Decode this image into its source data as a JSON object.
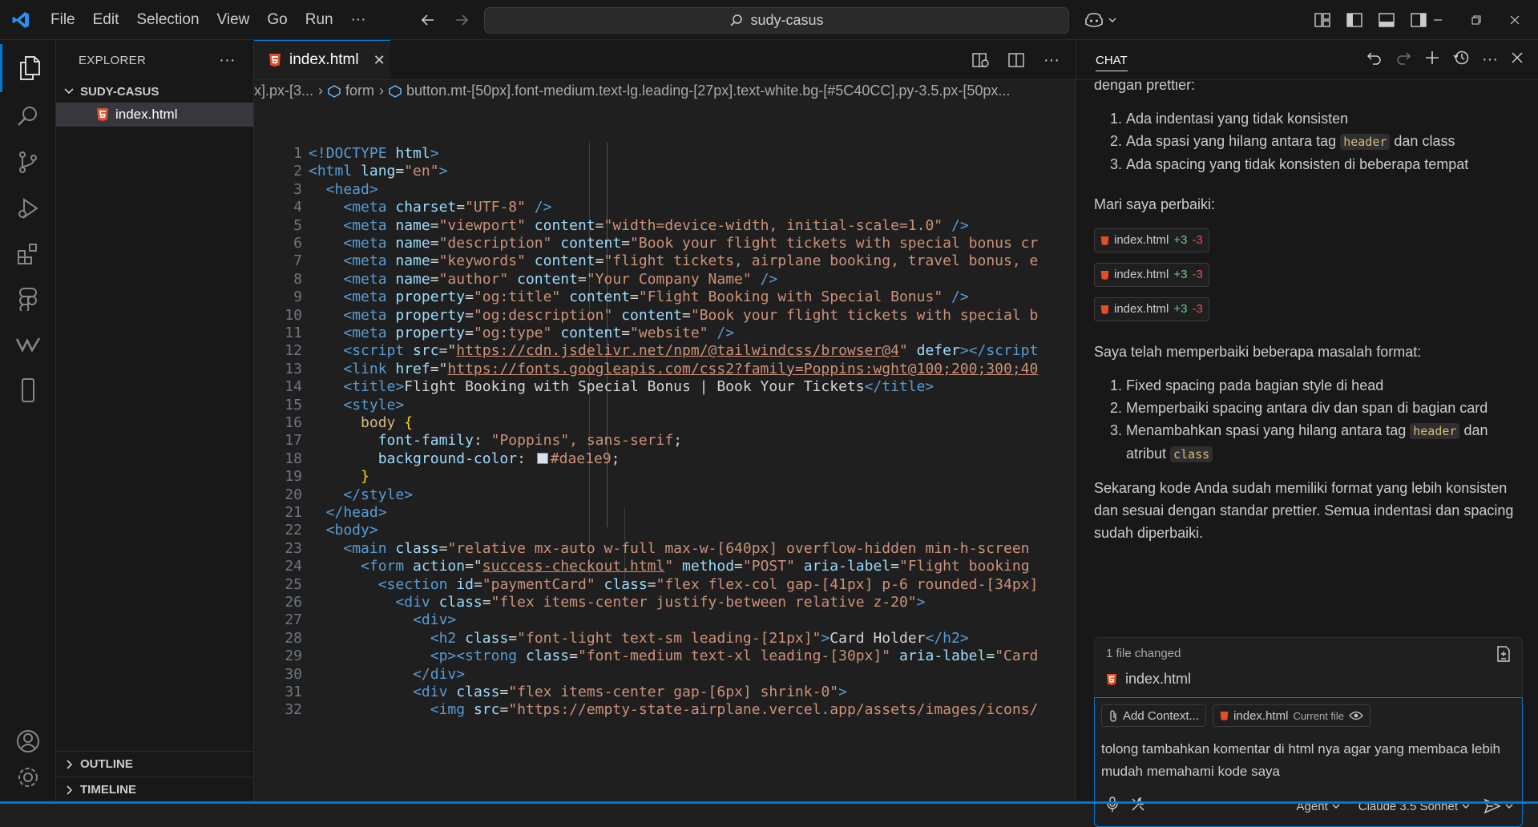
{
  "menu": [
    "File",
    "Edit",
    "Selection",
    "View",
    "Go",
    "Run",
    "···"
  ],
  "search": {
    "text": "sudy-casus"
  },
  "sidebar": {
    "title": "EXPLORER",
    "folder": "SUDY-CASUS",
    "files": [
      "index.html"
    ],
    "outline": "OUTLINE",
    "timeline": "TIMELINE"
  },
  "editor": {
    "tab": "index.html",
    "breadcrumb": {
      "part1": "x].px-[3...",
      "part2": "form",
      "part3": "button.mt-[50px].font-medium.text-lg.leading-[27px].text-white.bg-[#5C40CC].py-3.5.px-[50px..."
    },
    "swatch_color": "#dae1e9",
    "lines": [
      "1",
      "2",
      "3",
      "4",
      "5",
      "6",
      "7",
      "8",
      "9",
      "10",
      "11",
      "12",
      "13",
      "14",
      "15",
      "16",
      "17",
      "18",
      "19",
      "20",
      "21",
      "22",
      "23",
      "24",
      "25",
      "26",
      "27",
      "28",
      "29",
      "30",
      "31",
      "32"
    ],
    "code": {
      "l1": [
        "<!DOCTYPE",
        " html",
        ">"
      ],
      "l2": [
        "<html",
        " lang",
        "=",
        "\"en\"",
        ">"
      ],
      "l3": [
        "<head>"
      ],
      "l4": [
        "<meta",
        " charset",
        "=",
        "\"UTF-8\"",
        " />"
      ],
      "l5": [
        "<meta",
        " name",
        "=",
        "\"viewport\"",
        " content",
        "=",
        "\"width=device-width, initial-scale=1.0\"",
        " />"
      ],
      "l6": [
        "<meta",
        " name",
        "=",
        "\"description\"",
        " content",
        "=",
        "\"Book your flight tickets with special bonus cr"
      ],
      "l7": [
        "<meta",
        " name",
        "=",
        "\"keywords\"",
        " content",
        "=",
        "\"flight tickets, airplane booking, travel bonus, e"
      ],
      "l8": [
        "<meta",
        " name",
        "=",
        "\"author\"",
        " content",
        "=",
        "\"Your Company Name\"",
        " />"
      ],
      "l9": [
        "<meta",
        " property",
        "=",
        "\"og:title\"",
        " content",
        "=",
        "\"Flight Booking with Special Bonus\"",
        " />"
      ],
      "l10": [
        "<meta",
        " property",
        "=",
        "\"og:description\"",
        " content",
        "=",
        "\"Book your flight tickets with special b"
      ],
      "l11": [
        "<meta",
        " property",
        "=",
        "\"og:type\"",
        " content",
        "=",
        "\"website\"",
        " />"
      ],
      "l12": [
        "<script",
        " src",
        "=\"",
        "https://cdn.jsdelivr.net/npm/@tailwindcss/browser@4",
        "\"",
        " defer",
        "></script"
      ],
      "l13": [
        "<link",
        " href",
        "=\"",
        "https://fonts.googleapis.com/css2?family=Poppins:wght@100;200;300;40"
      ],
      "l14": [
        "<title>",
        "Flight Booking with Special Bonus | Book Your Tickets",
        "</title>"
      ],
      "l15": [
        "<style>"
      ],
      "l16": [
        "body",
        " {"
      ],
      "l17": [
        "font-family",
        ": ",
        "\"Poppins\", sans-serif",
        ";"
      ],
      "l18": [
        "background-color",
        ": ",
        "#dae1e9",
        ";"
      ],
      "l19": [
        "}"
      ],
      "l20": [
        "</style>"
      ],
      "l21": [
        "</head>"
      ],
      "l22": [
        "<body>"
      ],
      "l23": [
        "<main",
        " class",
        "=",
        "\"relative mx-auto w-full max-w-[640px] overflow-hidden min-h-screen"
      ],
      "l24": [
        "<form",
        " action",
        "=\"",
        "success-checkout.html",
        "\"",
        " method",
        "=",
        "\"POST\"",
        " aria-label",
        "=",
        "\"Flight booking"
      ],
      "l25": [
        "<section",
        " id",
        "=",
        "\"paymentCard\"",
        " class",
        "=",
        "\"flex flex-col gap-[41px] p-6 rounded-[34px]"
      ],
      "l26": [
        "<div",
        " class",
        "=",
        "\"flex items-center justify-between relative z-20\"",
        ">"
      ],
      "l27": [
        "<div>"
      ],
      "l28": [
        "<h2",
        " class",
        "=",
        "\"font-light text-sm leading-[21px]\"",
        ">",
        "Card Holder",
        "</h2>"
      ],
      "l29": [
        "<p>",
        "<strong",
        " class",
        "=",
        "\"font-medium text-xl leading-[30px]\"",
        " aria-label",
        "=",
        "\"Card"
      ],
      "l30": [
        "</div>"
      ],
      "l31": [
        "<div",
        " class",
        "=",
        "\"flex items-center gap-[6px] shrink-0\"",
        ">"
      ],
      "l32": [
        "<img",
        " src",
        "=",
        "\"https://empty-state-airplane.vercel.app/assets/images/icons/"
      ]
    }
  },
  "chat": {
    "title": "CHAT",
    "intro": "dengan prettier:",
    "list1": [
      "Ada indentasi yang tidak konsisten",
      "Ada spasi yang hilang antara tag",
      "dan class",
      "Ada spacing yang tidak konsisten di beberapa tempat"
    ],
    "chip_header": "header",
    "fix_text": "Mari saya perbaiki:",
    "edits": [
      {
        "file": "index.html",
        "plus": "+3",
        "minus": "-3"
      },
      {
        "file": "index.html",
        "plus": "+3",
        "minus": "-3"
      },
      {
        "file": "index.html",
        "plus": "+3",
        "minus": "-3"
      }
    ],
    "summary": "Saya telah memperbaiki beberapa masalah format:",
    "list2": [
      "Fixed spacing pada bagian style di head",
      "Memperbaiki spacing antara div dan span di bagian card",
      "Menambahkan spasi yang hilang antara tag",
      "dan",
      "atribut"
    ],
    "chip_class": "class",
    "closing": "Sekarang kode Anda sudah memiliki format yang lebih konsisten dan sesuai dengan standar prettier. Semua indentasi dan spacing sudah diperbaiki.",
    "changed_label": "1 file changed",
    "changed_file": "index.html",
    "add_context": "Add Context...",
    "current_file": "index.html",
    "current_file_label": "Current file",
    "input_text": "tolong tambahkan komentar di html nya agar yang membaca lebih mudah memahami kode saya",
    "mode": "Agent",
    "model": "Claude 3.5 Sonnet"
  }
}
